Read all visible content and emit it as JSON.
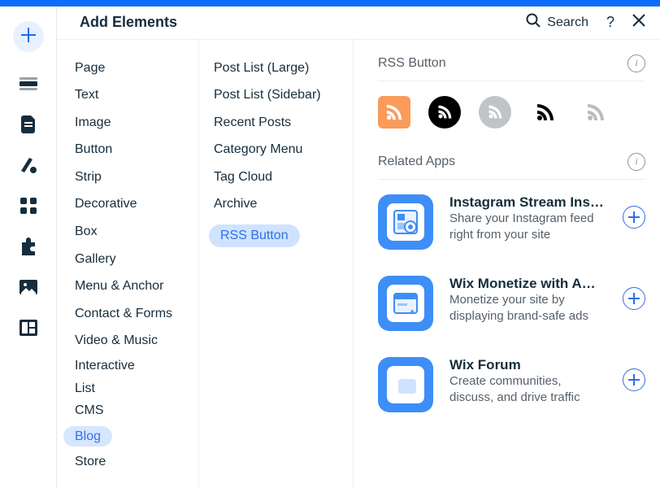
{
  "header": {
    "title": "Add Elements",
    "search_label": "Search"
  },
  "categories": [
    "Page",
    "Text",
    "Image",
    "Button",
    "Strip",
    "Decorative",
    "Box",
    "Gallery",
    "Menu & Anchor",
    "Contact & Forms",
    "Video & Music",
    "Interactive",
    "List",
    "CMS",
    "Blog",
    "Store"
  ],
  "categories_selected": "Blog",
  "sublist": [
    "Post List (Large)",
    "Post List (Sidebar)",
    "Recent Posts",
    "Category Menu",
    "Tag Cloud",
    "Archive",
    "RSS Button"
  ],
  "sublist_selected": "RSS Button",
  "detail": {
    "rss_section_title": "RSS Button",
    "related_title": "Related Apps",
    "apps": [
      {
        "title": "Instagram Stream Ins…",
        "desc": "Share your Instagram feed right from your site"
      },
      {
        "title": "Wix Monetize with A…",
        "desc": "Monetize your site by displaying brand-safe ads"
      },
      {
        "title": "Wix Forum",
        "desc": "Create communities, discuss, and drive traffic"
      }
    ]
  }
}
